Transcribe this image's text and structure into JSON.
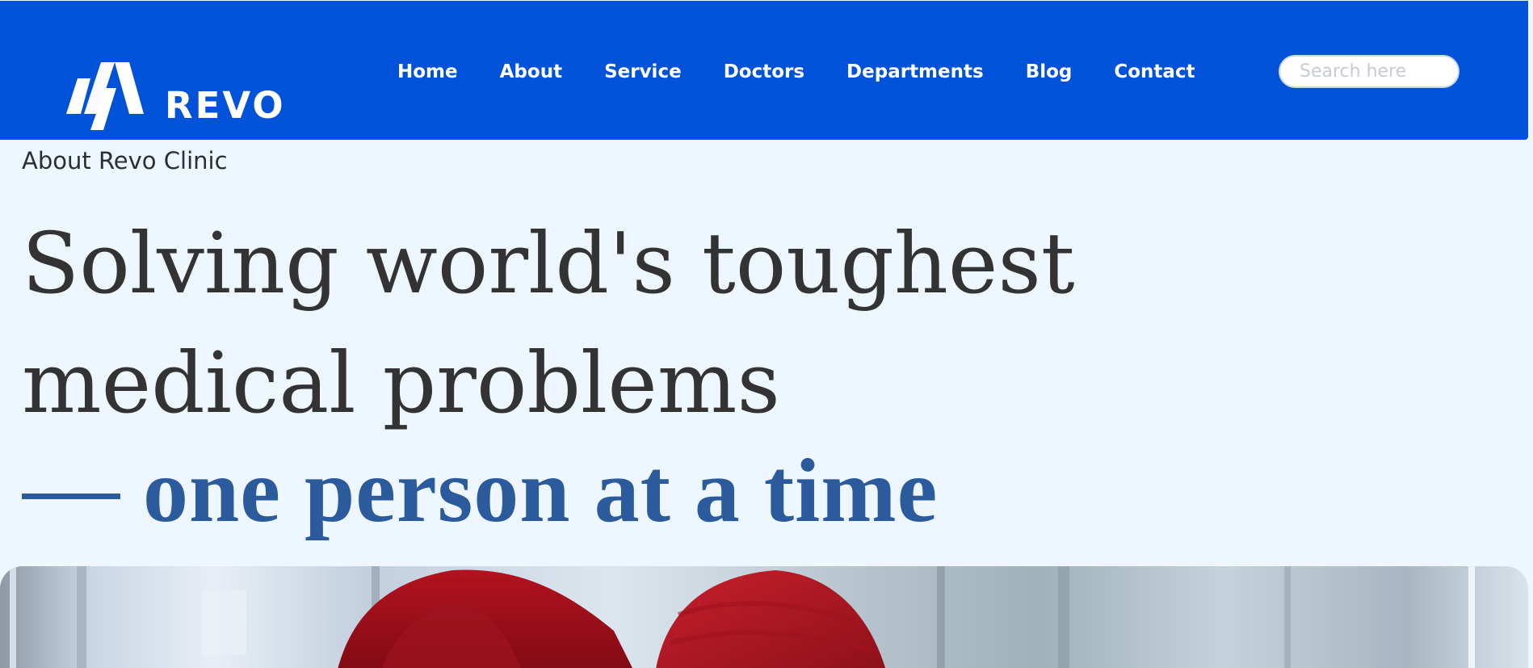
{
  "brand": {
    "name": "REVO"
  },
  "nav": {
    "items": [
      {
        "label": "Home"
      },
      {
        "label": "About"
      },
      {
        "label": "Service"
      },
      {
        "label": "Doctors"
      },
      {
        "label": "Departments"
      },
      {
        "label": "Blog"
      },
      {
        "label": "Contact"
      }
    ]
  },
  "search": {
    "placeholder": "Search here",
    "value": ""
  },
  "about": {
    "eyebrow": "About Revo Clinic",
    "headline": "Solving world's toughest medical problems",
    "tagline_dash": "—",
    "tagline": "one person at a time"
  },
  "hero": {
    "icon": "hero-photo-image"
  },
  "colors": {
    "header_bg": "#0052d9",
    "page_bg": "#eef7ff",
    "headline_text": "#333333",
    "tagline_accent": "#2b5a9d",
    "nav_text": "#ffffff"
  }
}
